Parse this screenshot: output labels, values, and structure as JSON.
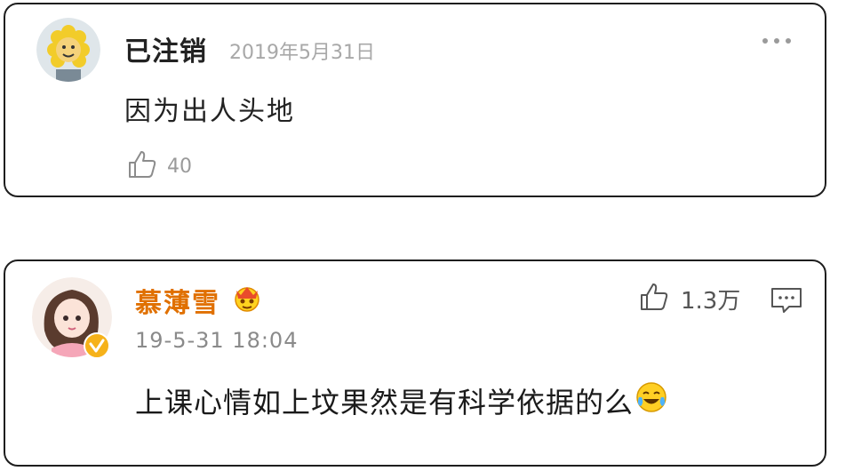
{
  "comment1": {
    "username": "已注销",
    "date": "2019年5月31日",
    "text": "因为出人头地",
    "like_count": "40",
    "icons": {
      "avatar": "sun-face-avatar",
      "like": "thumb-up-icon",
      "more": "more-dots-icon"
    }
  },
  "comment2": {
    "username": "慕薄雪",
    "time": "19-5-31 18:04",
    "text": "上课心情如上坟果然是有科学依据的么",
    "like_count": "1.3万",
    "icons": {
      "avatar": "girl-avatar",
      "verified": "verified-badge-icon",
      "crown": "crown-emoji-icon",
      "like": "thumb-up-icon",
      "reply": "reply-bubble-icon",
      "emoji": "laugh-cry-emoji-icon"
    }
  },
  "colors": {
    "username_vip": "#e07000",
    "text_primary": "#222222",
    "text_secondary": "#9a9a9a",
    "card_border": "#1e1e1e"
  }
}
